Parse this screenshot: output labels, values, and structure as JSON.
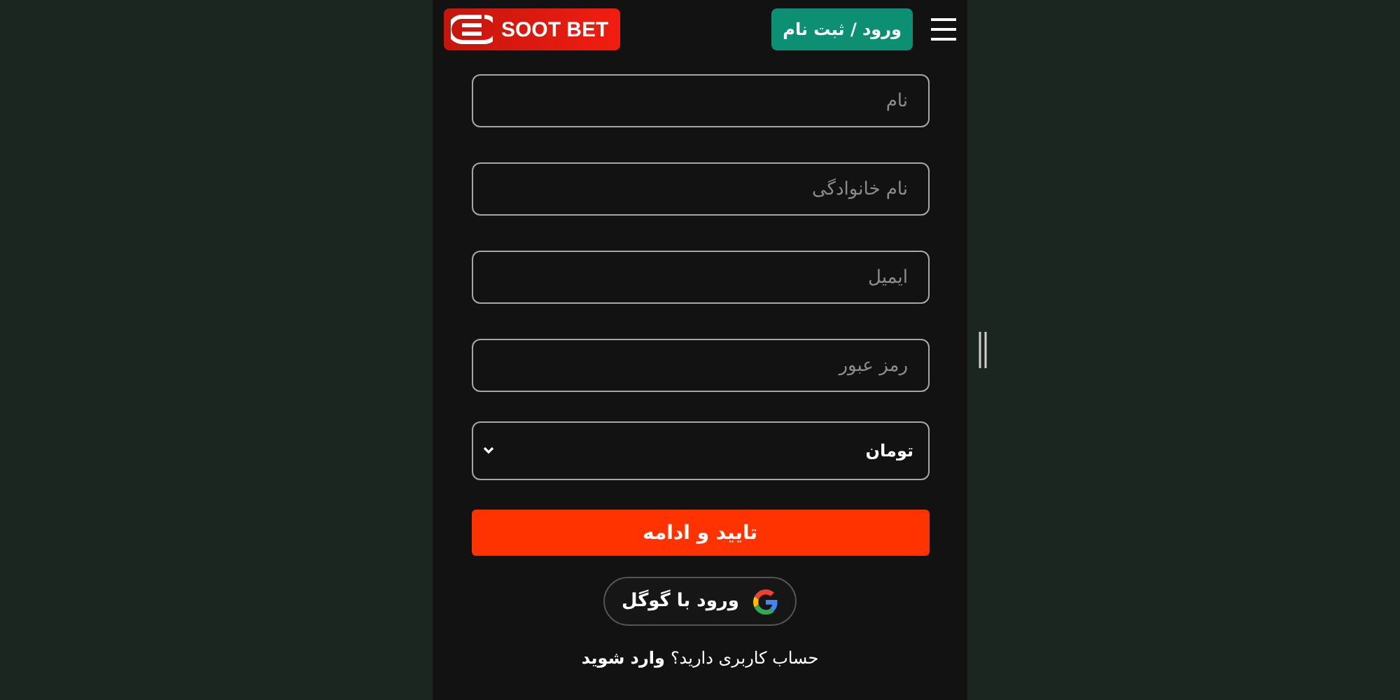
{
  "header": {
    "logo": "SOOT BET",
    "login_button": "ورود / ثبت نام"
  },
  "fields": [
    {
      "placeholder": "نام"
    },
    {
      "placeholder": "نام خانوادگی"
    },
    {
      "placeholder": "ایمیل"
    },
    {
      "placeholder": "رمز عبور"
    }
  ],
  "currency_select": {
    "value": "تومان"
  },
  "submit_button": "تایید و ادامه",
  "google_button": "ورود با گوگل",
  "footer": {
    "question": "حساب کاربری دارید؟",
    "link": "وارد شوید"
  }
}
